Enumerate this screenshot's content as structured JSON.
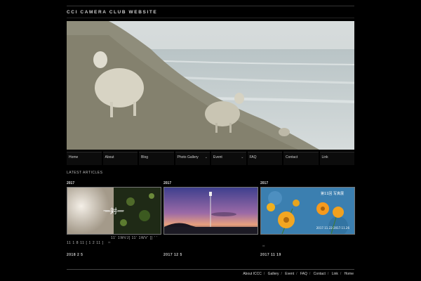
{
  "site": {
    "title": "CCI CAMERA CLUB WEBSITE"
  },
  "nav": [
    {
      "label": "Home",
      "dropdown": false
    },
    {
      "label": "About",
      "dropdown": false
    },
    {
      "label": "Blog",
      "dropdown": false
    },
    {
      "label": "Photo Gallery",
      "dropdown": true
    },
    {
      "label": "Event",
      "dropdown": true
    },
    {
      "label": "FAQ",
      "dropdown": false
    },
    {
      "label": "Contact",
      "dropdown": false
    },
    {
      "label": "Link",
      "dropdown": false
    }
  ],
  "latest_heading": "LATEST ARTICLES",
  "cards": [
    {
      "year": "2017",
      "overlay_text": "一対一",
      "caption": "11 1 8 11 [ 1 2 11 ]",
      "date": "2018 2 5"
    },
    {
      "year": "2017",
      "overlay_text": "",
      "caption": "11' 1WVJ[ 11' 1WV' []  ' '",
      "date": "2017 12 5"
    },
    {
      "year": "2017",
      "overlay_text": "第11回 写真展",
      "overlay_sub": "2017.11.22-2017.11.26",
      "caption": "",
      "date": "2017 11 19"
    }
  ],
  "footer": {
    "links": [
      "About ICCC",
      "Gallery",
      "Event",
      "FAQ",
      "Contact",
      "Link",
      "Home"
    ]
  },
  "colors": {
    "background": "#000000",
    "nav_bg": "#0c0c0c",
    "text": "#dddddd"
  }
}
